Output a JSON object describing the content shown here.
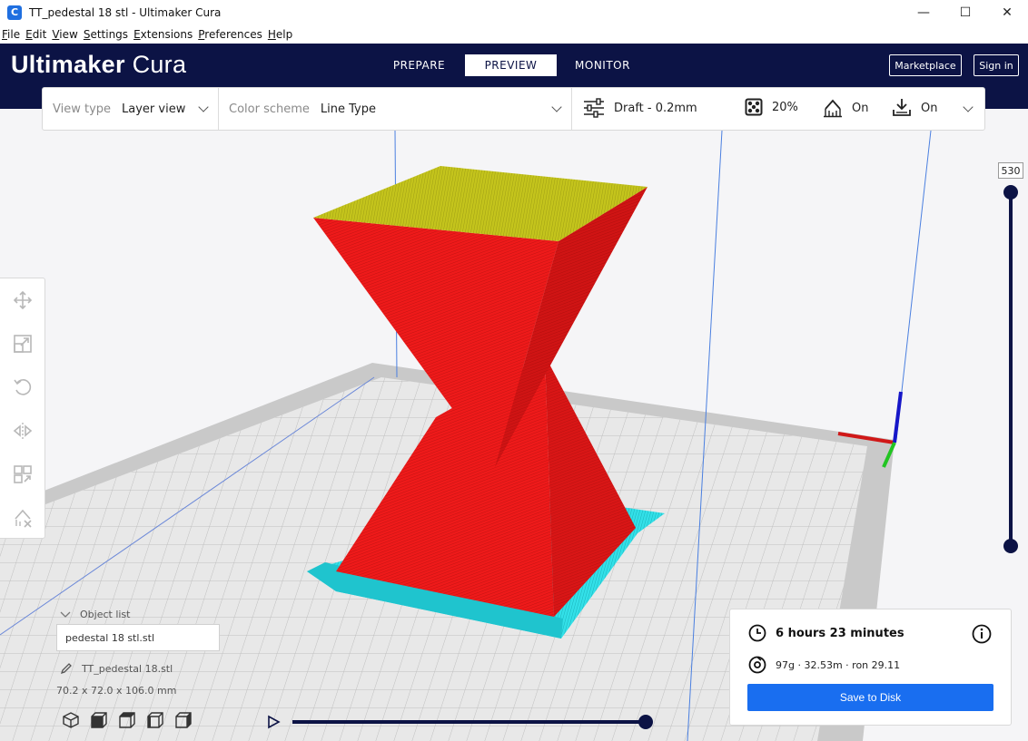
{
  "window": {
    "title": "TT_pedestal 18 stl - Ultimaker Cura",
    "app_icon": "C",
    "controls": [
      "—",
      "☐",
      "✕"
    ]
  },
  "menu": [
    "File",
    "Edit",
    "View",
    "Settings",
    "Extensions",
    "Preferences",
    "Help"
  ],
  "header": {
    "logo_bold": "Ultimaker",
    "logo_light": " Cura",
    "tabs": [
      "PREPARE",
      "PREVIEW",
      "MONITOR"
    ],
    "active_tab": "PREVIEW",
    "marketplace": "Marketplace",
    "signin": "Sign in"
  },
  "viewbar": {
    "view_type_label": "View type",
    "view_type_value": "Layer view",
    "color_scheme_label": "Color scheme",
    "color_scheme_value": "Line Type",
    "profile": "Draft - 0.2mm",
    "infill": "20%",
    "support": "On",
    "adhesion": "On"
  },
  "layer_slider": {
    "value": "530"
  },
  "object_list": {
    "header": "Object list",
    "filename": "pedestal 18 stl.stl",
    "object_name": "TT_pedestal 18.stl",
    "dimensions": "70.2 x 72.0 x 106.0 mm"
  },
  "print": {
    "time": "6 hours 23 minutes",
    "material": "97g · 32.53m · ron 29.11",
    "save_label": "Save to Disk"
  },
  "colors": {
    "header": "#0c1345",
    "accent": "#196ef0",
    "wall": "#e81a1a",
    "top_skin": "#b8b81a",
    "brim": "#2ad8e0"
  },
  "icons": {
    "tools": [
      "move-icon",
      "scale-icon",
      "rotate-icon",
      "mirror-icon",
      "per-model-settings-icon",
      "support-blocker-icon"
    ],
    "view_cubes": [
      "3d-view-icon",
      "front-view-icon",
      "top-view-icon",
      "left-view-icon",
      "right-view-icon"
    ]
  }
}
